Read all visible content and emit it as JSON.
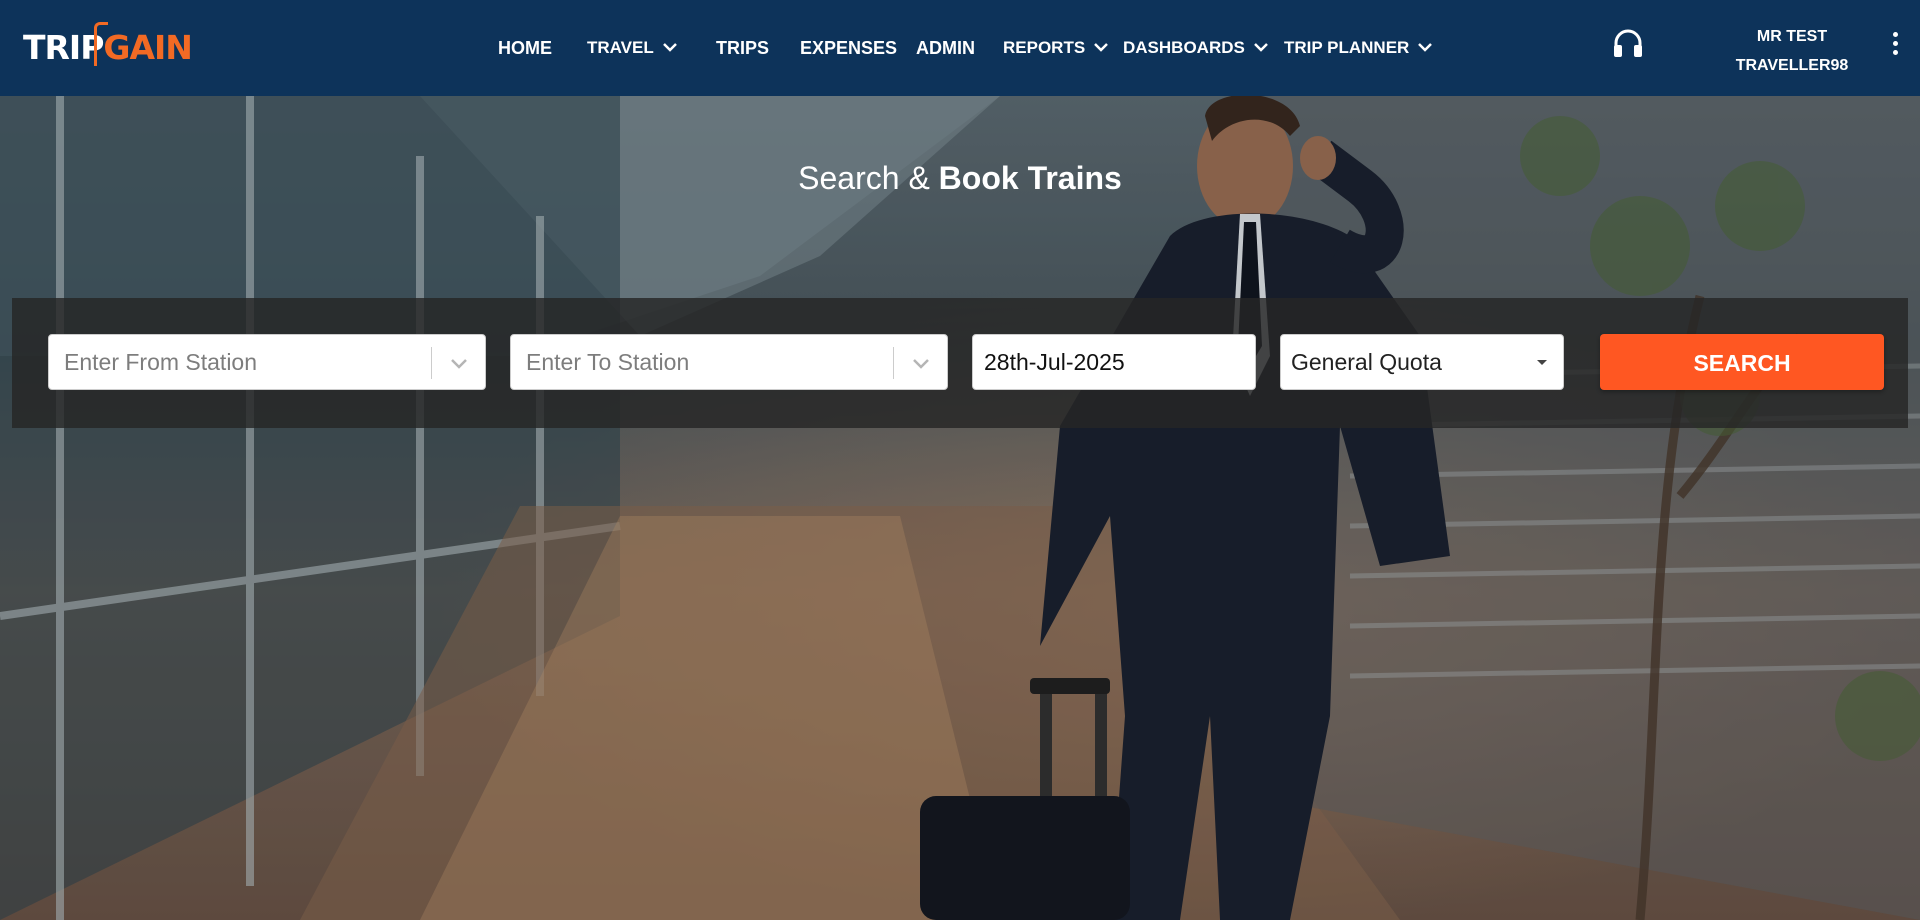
{
  "brand": {
    "logo_part1": "TRIP",
    "logo_part2": "GAIN"
  },
  "nav": {
    "items": [
      {
        "label": "HOME",
        "has_dropdown": false
      },
      {
        "label": "TRAVEL",
        "has_dropdown": true
      },
      {
        "label": "TRIPS",
        "has_dropdown": false
      },
      {
        "label": "EXPENSES",
        "has_dropdown": false
      },
      {
        "label": "ADMIN",
        "has_dropdown": false
      },
      {
        "label": "REPORTS",
        "has_dropdown": true
      },
      {
        "label": "DASHBOARDS",
        "has_dropdown": true
      },
      {
        "label": "TRIP PLANNER",
        "has_dropdown": true
      }
    ],
    "support_icon": "headset-icon",
    "user": {
      "line1": "MR TEST",
      "line2": "TRAVELLER98"
    },
    "more_icon": "kebab-menu-icon"
  },
  "hero": {
    "title_prefix": "Search &",
    "title_strong": "Book Trains"
  },
  "search": {
    "from_placeholder": "Enter From Station",
    "to_placeholder": "Enter To Station",
    "date_value": "28th-Jul-2025",
    "quota_value": "General Quota",
    "button_label": "SEARCH"
  },
  "colors": {
    "navbar": "#0d335a",
    "accent": "#ff5722",
    "logo_orange": "#f26a24"
  }
}
